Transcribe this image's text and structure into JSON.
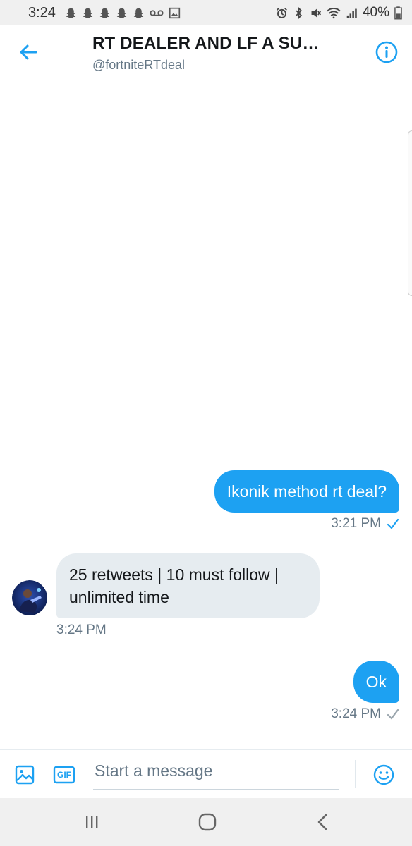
{
  "status_bar": {
    "time": "3:24",
    "battery": "40%",
    "left_icons": [
      "snapchat-icon",
      "snapchat-icon",
      "snapchat-icon",
      "snapchat-icon",
      "snapchat-icon",
      "voicemail-icon",
      "image-icon"
    ],
    "right_icons": [
      "alarm-icon",
      "bluetooth-icon",
      "mute-icon",
      "wifi-icon",
      "signal-icon"
    ]
  },
  "header": {
    "title": "RT DEALER AND LF A SU…",
    "handle": "@fortniteRTdeal",
    "back_icon": "arrow-left-icon",
    "info_icon": "info-icon"
  },
  "messages": [
    {
      "direction": "outgoing",
      "text": "Ikonik method rt deal?",
      "time": "3:21 PM",
      "status": "read"
    },
    {
      "direction": "incoming",
      "text": "25 retweets | 10 must follow | unlimited time",
      "time": "3:24 PM"
    },
    {
      "direction": "outgoing",
      "text": "Ok",
      "time": "3:24 PM",
      "status": "sent"
    }
  ],
  "composer": {
    "placeholder": "Start a message",
    "gif_label": "GIF",
    "image_icon": "image-icon",
    "emoji_icon": "emoji-icon"
  },
  "nav_bar": {
    "icons": [
      "recents-icon",
      "home-icon",
      "back-icon"
    ]
  },
  "colors": {
    "accent": "#1da1f2",
    "incoming_bubble": "#e6ecf0",
    "secondary_text": "#657786"
  }
}
